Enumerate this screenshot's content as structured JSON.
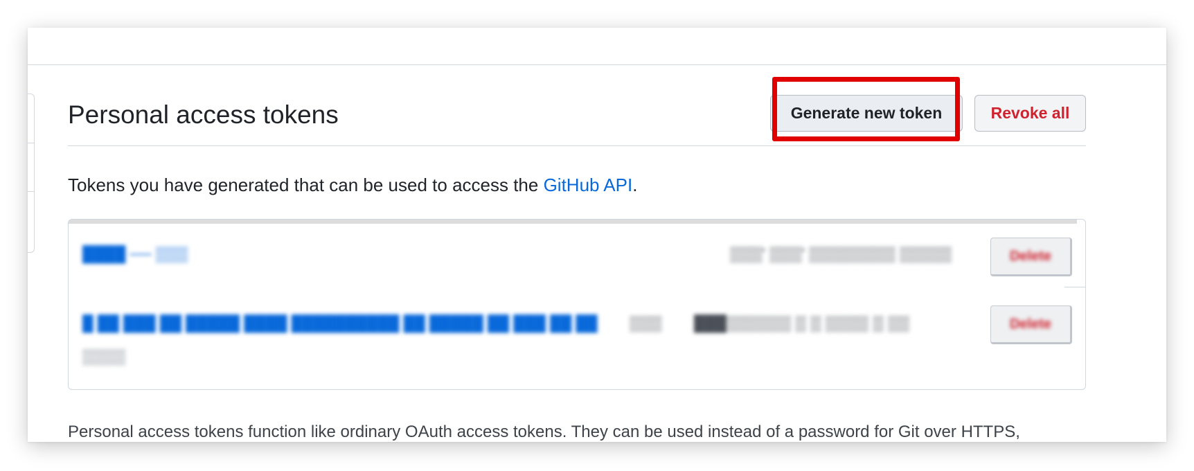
{
  "header": {
    "title": "Personal access tokens",
    "generate_button": "Generate new token",
    "revoke_all_button": "Revoke all"
  },
  "intro": {
    "text_before": "Tokens you have generated that can be used to access the ",
    "link_text": "GitHub API",
    "text_after": "."
  },
  "tokens": [
    {
      "name": "████ ── ▒▒▒",
      "meta": "▒▒▒' ▒▒▒' ▒▒▒▒▒▒▒▒ ▒▒▒▒▒▒▒▒",
      "revoke_label": "Delete"
    },
    {
      "name": "█ ██ ███ ██ █████ ████ ██████████ ██ █████ ██ ███ ██ ██",
      "scope": "▒▒▒",
      "meta": "███▒▒▒▒▒▒ ▒ ▒ ▒▒▒▒ ▒ ▒▒",
      "subline": "▒▒▒▒",
      "revoke_label": "Delete"
    }
  ],
  "footer": {
    "text": "Personal access tokens function like ordinary OAuth access tokens. They can be used instead of a password for Git over HTTPS,"
  },
  "colors": {
    "link": "#0969da",
    "danger": "#cf222e",
    "highlight": "#e00000",
    "border": "#d0d7de"
  }
}
